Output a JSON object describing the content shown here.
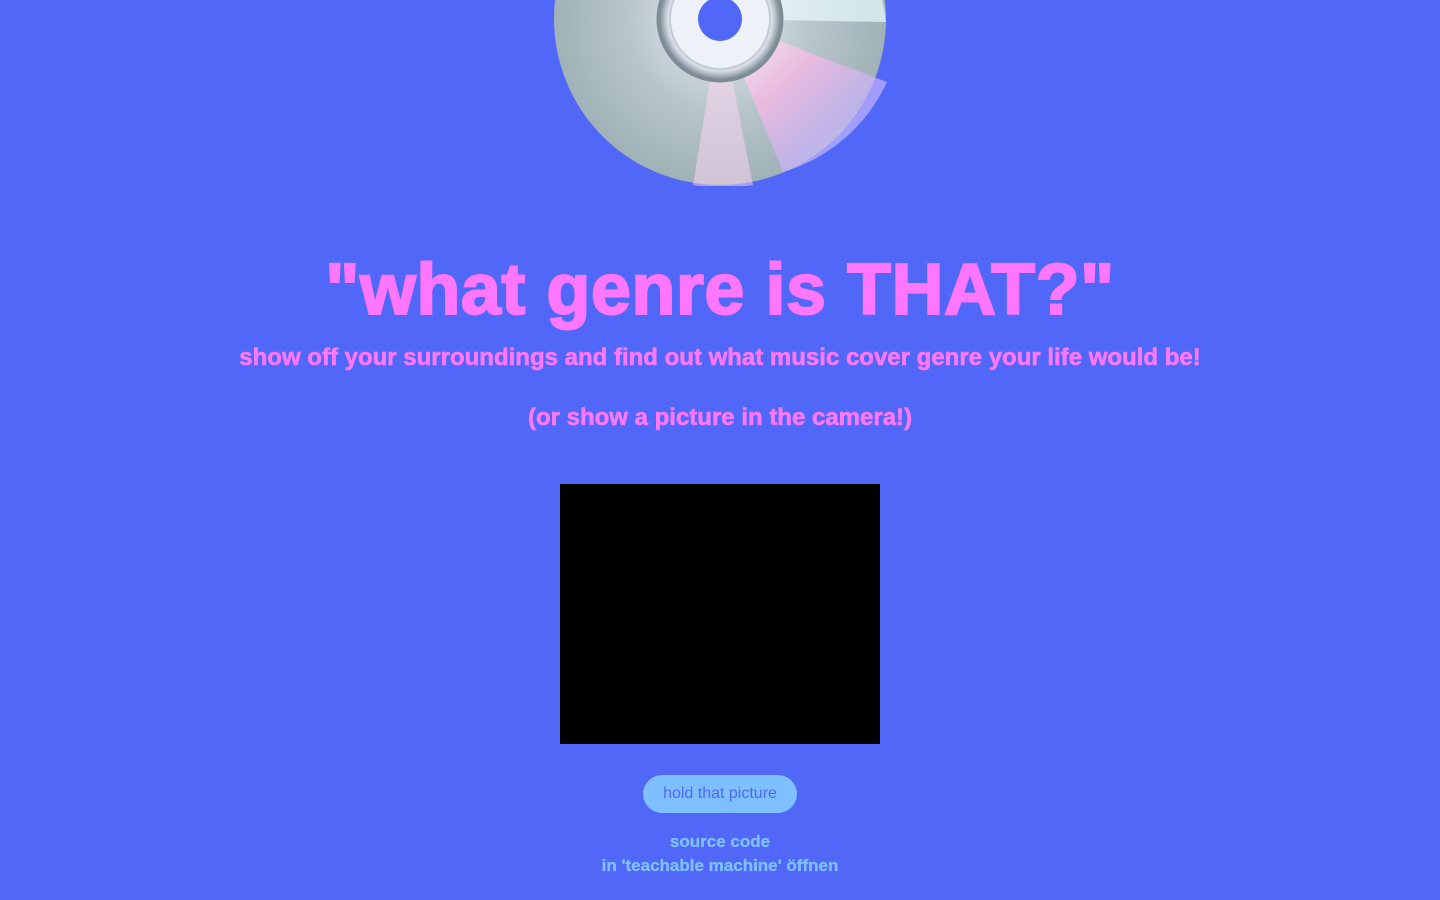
{
  "header": {
    "cd_image": "compact-disc-icon"
  },
  "main": {
    "title": "\"what genre is THAT?\"",
    "subtitle": "show off your surroundings and find out what music cover genre your life would be!",
    "subnote": "(or show a picture in the camera!)",
    "hold_button_label": "hold that picture"
  },
  "footer": {
    "source_code_label": "source code",
    "teachable_machine_label": "in 'teachable machine' öffnen"
  },
  "colors": {
    "background": "#5067f8",
    "accent_pink": "#ff77ff",
    "accent_light_blue": "#7ec0ff",
    "camera": "#000000"
  }
}
